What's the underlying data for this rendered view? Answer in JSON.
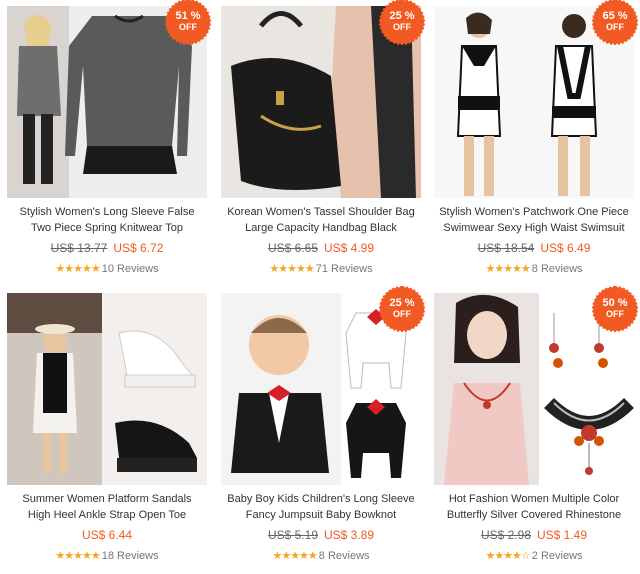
{
  "products": [
    {
      "title_line1": "Stylish Women's Long Sleeve False",
      "title_line2": "Two Piece Spring Knitwear Top",
      "old_price": "US$ 13.77",
      "new_price": "US$ 6.72",
      "badge_pct": "51 %",
      "badge_off": "OFF",
      "stars": "★★★★★",
      "reviews": "10 Reviews",
      "image_icon": "knitwear-image"
    },
    {
      "title_line1": "Korean Women's Tassel Shoulder Bag",
      "title_line2": "Large Capacity Handbag Black",
      "old_price": "US$ 6.65",
      "new_price": "US$ 4.99",
      "badge_pct": "25 %",
      "badge_off": "OFF",
      "stars": "★★★★★",
      "reviews": "71 Reviews",
      "image_icon": "handbag-image"
    },
    {
      "title_line1": "Stylish Women's Patchwork One Piece",
      "title_line2": "Swimwear Sexy High Waist Swimsuit",
      "old_price": "US$ 18.54",
      "new_price": "US$ 6.49",
      "badge_pct": "65 %",
      "badge_off": "OFF",
      "stars": "★★★★★",
      "reviews": "8 Reviews",
      "image_icon": "swimsuit-image"
    },
    {
      "title_line1": "Summer Women Platform Sandals",
      "title_line2": "High Heel Ankle Strap Open Toe",
      "old_price": "",
      "new_price": "US$ 6.44",
      "badge_pct": "",
      "badge_off": "",
      "stars": "★★★★★",
      "reviews": "18 Reviews",
      "image_icon": "sandals-image"
    },
    {
      "title_line1": "Baby Boy Kids Children's Long Sleeve",
      "title_line2": "Fancy Jumpsuit Baby Bowknot",
      "old_price": "US$ 5.19",
      "new_price": "US$ 3.89",
      "badge_pct": "25 %",
      "badge_off": "OFF",
      "stars": "★★★★★",
      "reviews": "8 Reviews",
      "image_icon": "baby-jumpsuit-image"
    },
    {
      "title_line1": "Hot Fashion Women Multiple Color",
      "title_line2": "Butterfly Silver Covered Rhinestone",
      "old_price": "US$ 2.98",
      "new_price": "US$ 1.49",
      "badge_pct": "50 %",
      "badge_off": "OFF",
      "stars": "★★★★☆",
      "reviews": "2 Reviews",
      "image_icon": "necklace-image"
    }
  ],
  "colors": {
    "accent": "#f15a22",
    "star": "#f5a623"
  }
}
